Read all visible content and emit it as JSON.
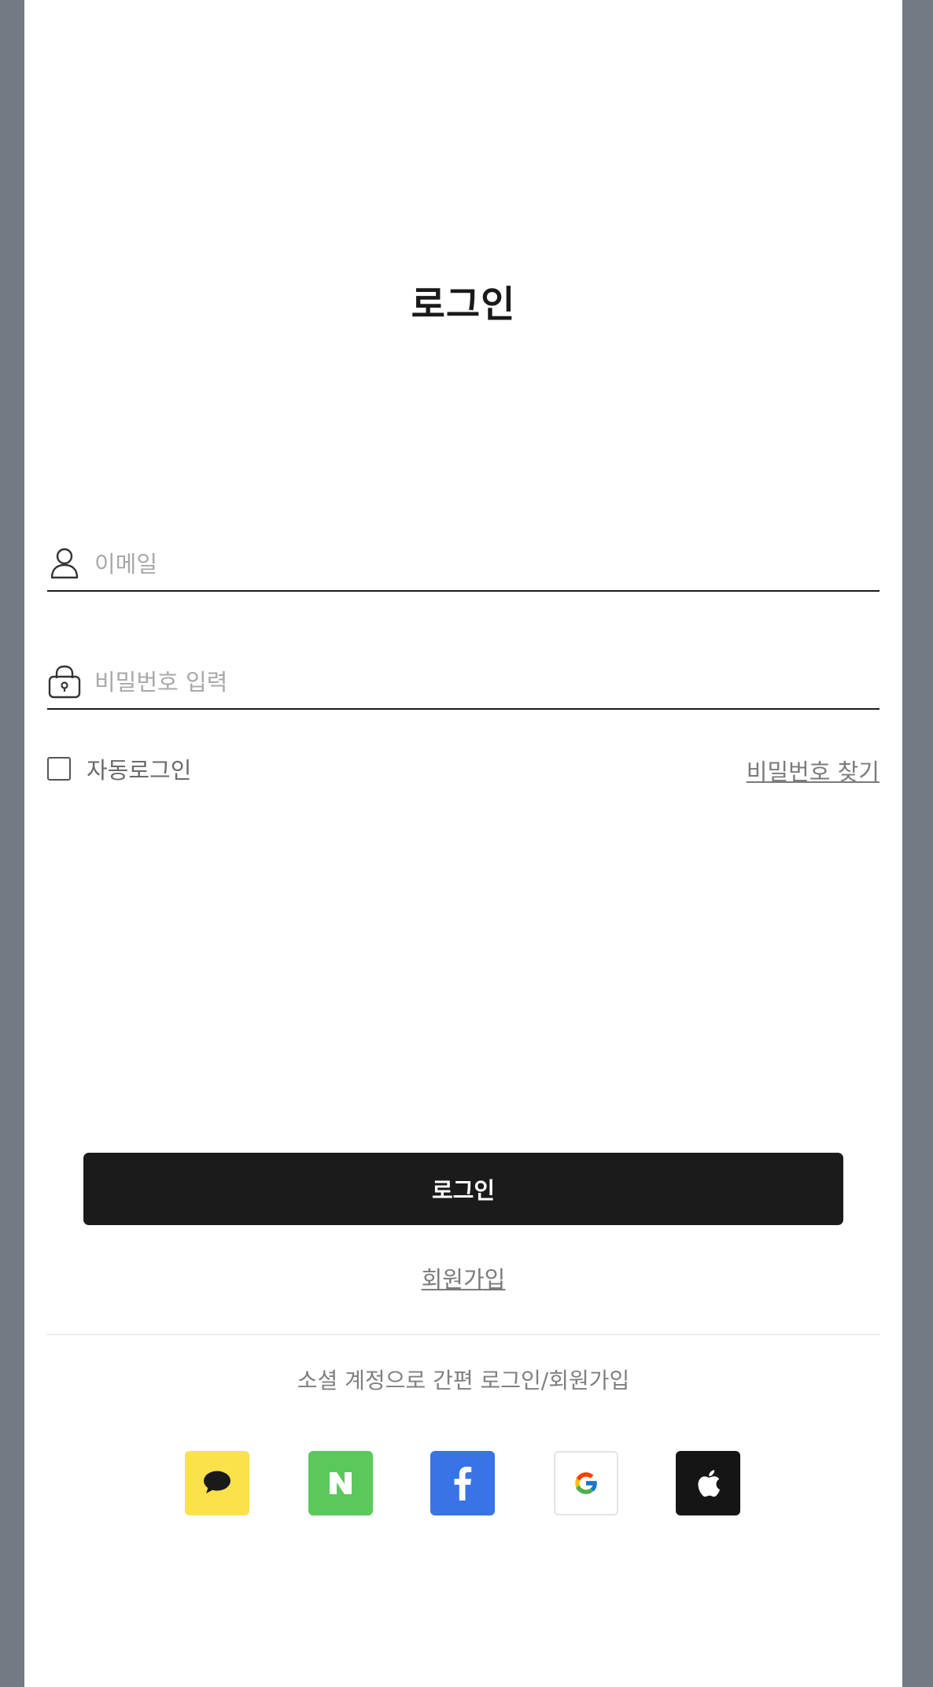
{
  "header": {
    "title": "로그인"
  },
  "form": {
    "email_placeholder": "이메일",
    "password_placeholder": "비밀번호 입력",
    "auto_login_label": "자동로그인",
    "auto_login_checked": false,
    "find_password_label": "비밀번호 찾기",
    "login_button_label": "로그인",
    "signup_label": "회원가입"
  },
  "social": {
    "caption": "소셜 계정으로 간편 로그인/회원가입",
    "providers": [
      {
        "name": "kakao",
        "icon": "speech-bubble-icon",
        "color": "#fbe14a"
      },
      {
        "name": "naver",
        "icon": "naver-n-icon",
        "color": "#5bc85c"
      },
      {
        "name": "facebook",
        "icon": "facebook-f-icon",
        "color": "#3873e8"
      },
      {
        "name": "google",
        "icon": "google-g-icon",
        "color": "#ffffff"
      },
      {
        "name": "apple",
        "icon": "apple-icon",
        "color": "#151515"
      }
    ]
  },
  "colors": {
    "background": "#737a83",
    "panel": "#ffffff",
    "primary_button": "#1b1b1b"
  }
}
